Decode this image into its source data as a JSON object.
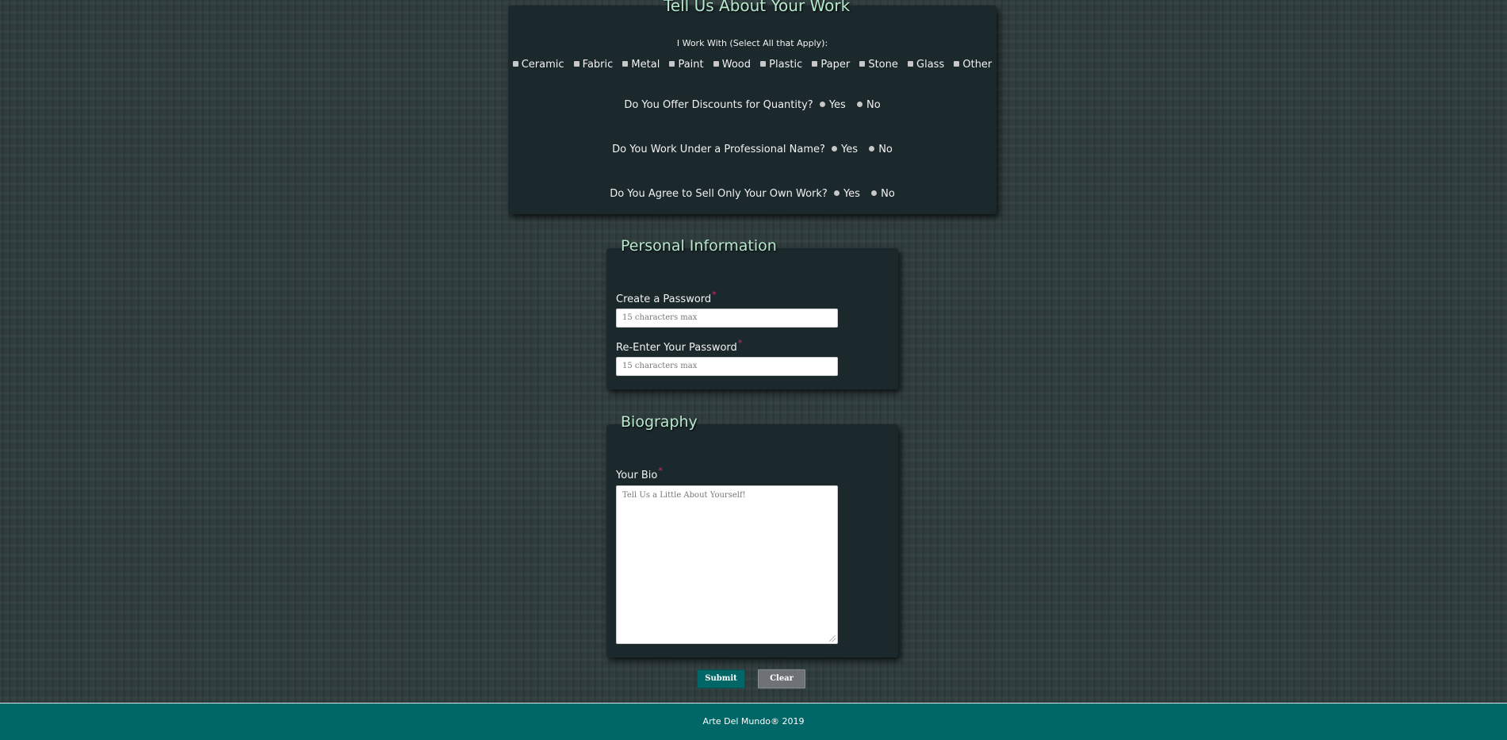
{
  "work_section": {
    "title": "Tell Us About Your Work",
    "materials_label": "I Work With (Select All that Apply):",
    "materials": [
      "Ceramic",
      "Fabric",
      "Metal",
      "Paint",
      "Wood",
      "Plastic",
      "Paper",
      "Stone",
      "Glass",
      "Other"
    ],
    "questions": [
      {
        "label": "Do You Offer Discounts for Quantity?",
        "yes": "Yes",
        "no": "No"
      },
      {
        "label": "Do You Work Under a Professional Name?",
        "yes": "Yes",
        "no": "No"
      },
      {
        "label": "Do You Agree to Sell Only Your Own Work?",
        "yes": "Yes",
        "no": "No"
      }
    ]
  },
  "personal_section": {
    "title": "Personal Information",
    "password_label": "Create a Password",
    "password_placeholder": "15 characters max",
    "reenter_label": "Re-Enter Your Password",
    "reenter_placeholder": "15 characters max",
    "required_mark": "*"
  },
  "bio_section": {
    "title": "Biography",
    "bio_label": "Your Bio",
    "bio_placeholder": "Tell Us a Little About Yourself!",
    "required_mark": "*"
  },
  "buttons": {
    "submit": "Submit",
    "clear": "Clear"
  },
  "footer": {
    "text": "Arte Del Mundo® 2019"
  },
  "colors": {
    "panel": "#1b282c",
    "legend": "#b7e8cc",
    "required": "#e0217a",
    "submit": "#006766",
    "clear": "#6e7276",
    "footer": "#006766"
  }
}
